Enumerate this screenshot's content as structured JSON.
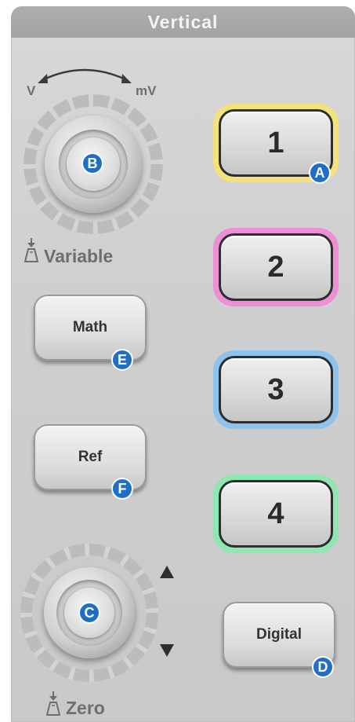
{
  "panel": {
    "title": "Vertical"
  },
  "scale_knob": {
    "left_label": "V",
    "right_label": "mV",
    "badge": "B",
    "push_label": "Variable"
  },
  "offset_knob": {
    "badge": "C",
    "push_label": "Zero"
  },
  "buttons": {
    "math": {
      "label": "Math",
      "badge": "E"
    },
    "ref": {
      "label": "Ref",
      "badge": "F"
    },
    "digital": {
      "label": "Digital",
      "badge": "D"
    }
  },
  "channels": [
    {
      "label": "1",
      "glow_color": "#f3e27a",
      "badge": "A"
    },
    {
      "label": "2",
      "glow_color": "#ee8ed4"
    },
    {
      "label": "3",
      "glow_color": "#8cc4ee"
    },
    {
      "label": "4",
      "glow_color": "#8ee6b0"
    }
  ],
  "colors": {
    "badge": "#1f6fc7",
    "header": "#a6a6a6"
  }
}
